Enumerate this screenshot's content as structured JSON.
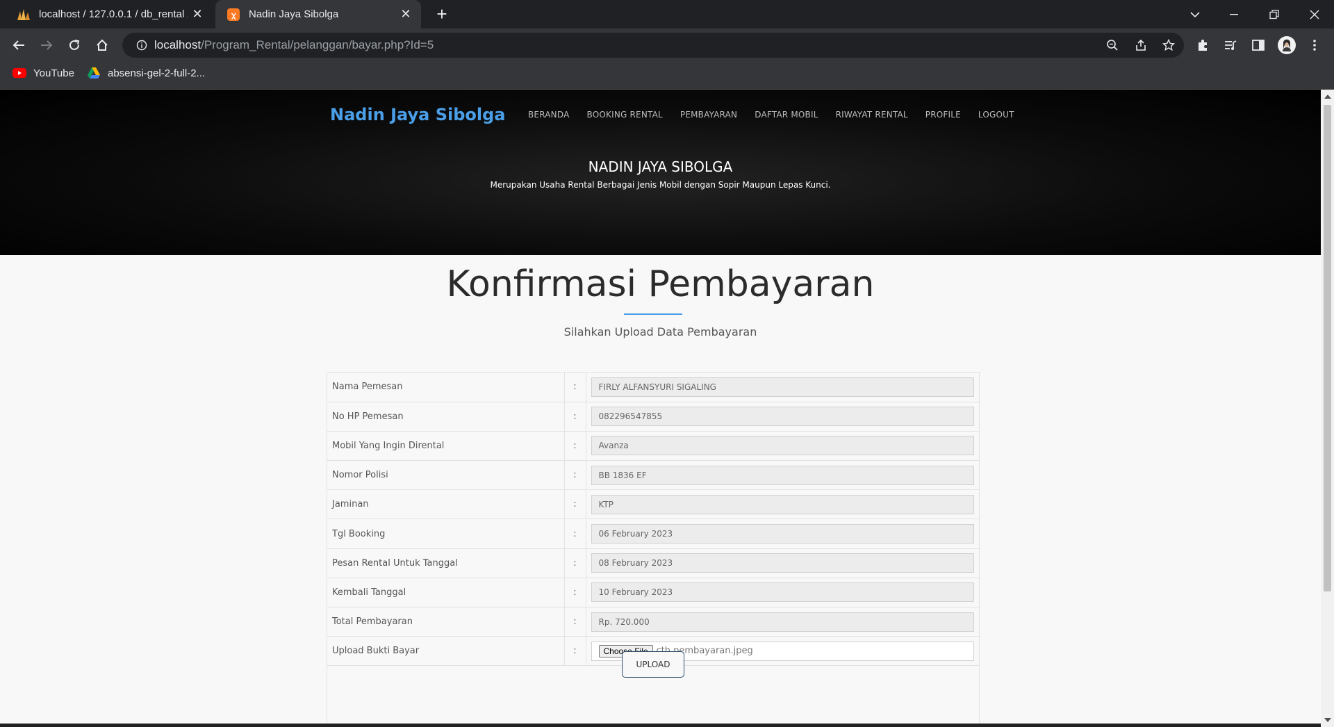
{
  "browser": {
    "tabs": [
      {
        "title": "localhost / 127.0.0.1 / db_rental /",
        "active": false,
        "icon": "phpmyadmin-icon"
      },
      {
        "title": "Nadin Jaya Sibolga",
        "active": true,
        "icon": "xampp-icon"
      }
    ],
    "url_host": "localhost",
    "url_path": "/Program_Rental/pelanggan/bayar.php?Id=5",
    "bookmarks": [
      {
        "label": "YouTube",
        "icon": "youtube-icon"
      },
      {
        "label": "absensi-gel-2-full-2...",
        "icon": "google-drive-icon"
      }
    ]
  },
  "site": {
    "brand": "Nadin Jaya Sibolga",
    "nav": [
      "BERANDA",
      "BOOKING RENTAL",
      "PEMBAYARAN",
      "DAFTAR MOBIL",
      "RIWAYAT RENTAL",
      "PROFILE",
      "LOGOUT"
    ],
    "hero_title": "NADIN JAYA SIBOLGA",
    "hero_subtitle": "Merupakan Usaha Rental Berbagai Jenis Mobil dengan Sopir Maupun Lepas Kunci."
  },
  "page": {
    "title": "Konfirmasi Pembayaran",
    "subtitle": "Silahkan Upload Data Pembayaran",
    "colon": ":",
    "fields": [
      {
        "label": "Nama Pemesan",
        "value": "FIRLY ALFANSYURI SIGALING"
      },
      {
        "label": "No HP Pemesan",
        "value": "082296547855"
      },
      {
        "label": "Mobil Yang Ingin Dirental",
        "value": "Avanza"
      },
      {
        "label": "Nomor Polisi",
        "value": "BB 1836 EF"
      },
      {
        "label": "Jaminan",
        "value": "KTP"
      },
      {
        "label": "Tgl Booking",
        "value": "06 February 2023"
      },
      {
        "label": "Pesan Rental Untuk Tanggal",
        "value": "08 February 2023"
      },
      {
        "label": "Kembali Tanggal",
        "value": "10 February 2023"
      },
      {
        "label": "Total Pembayaran",
        "value": "Rp. 720.000"
      }
    ],
    "upload": {
      "label": "Upload Bukti Bayar",
      "button": "Choose File",
      "filename": "cth pembayaran.jpeg"
    },
    "submit": "UPLOAD"
  },
  "colors": {
    "brand": "#4a9fe8",
    "accent_line": "#4a9fe8"
  }
}
